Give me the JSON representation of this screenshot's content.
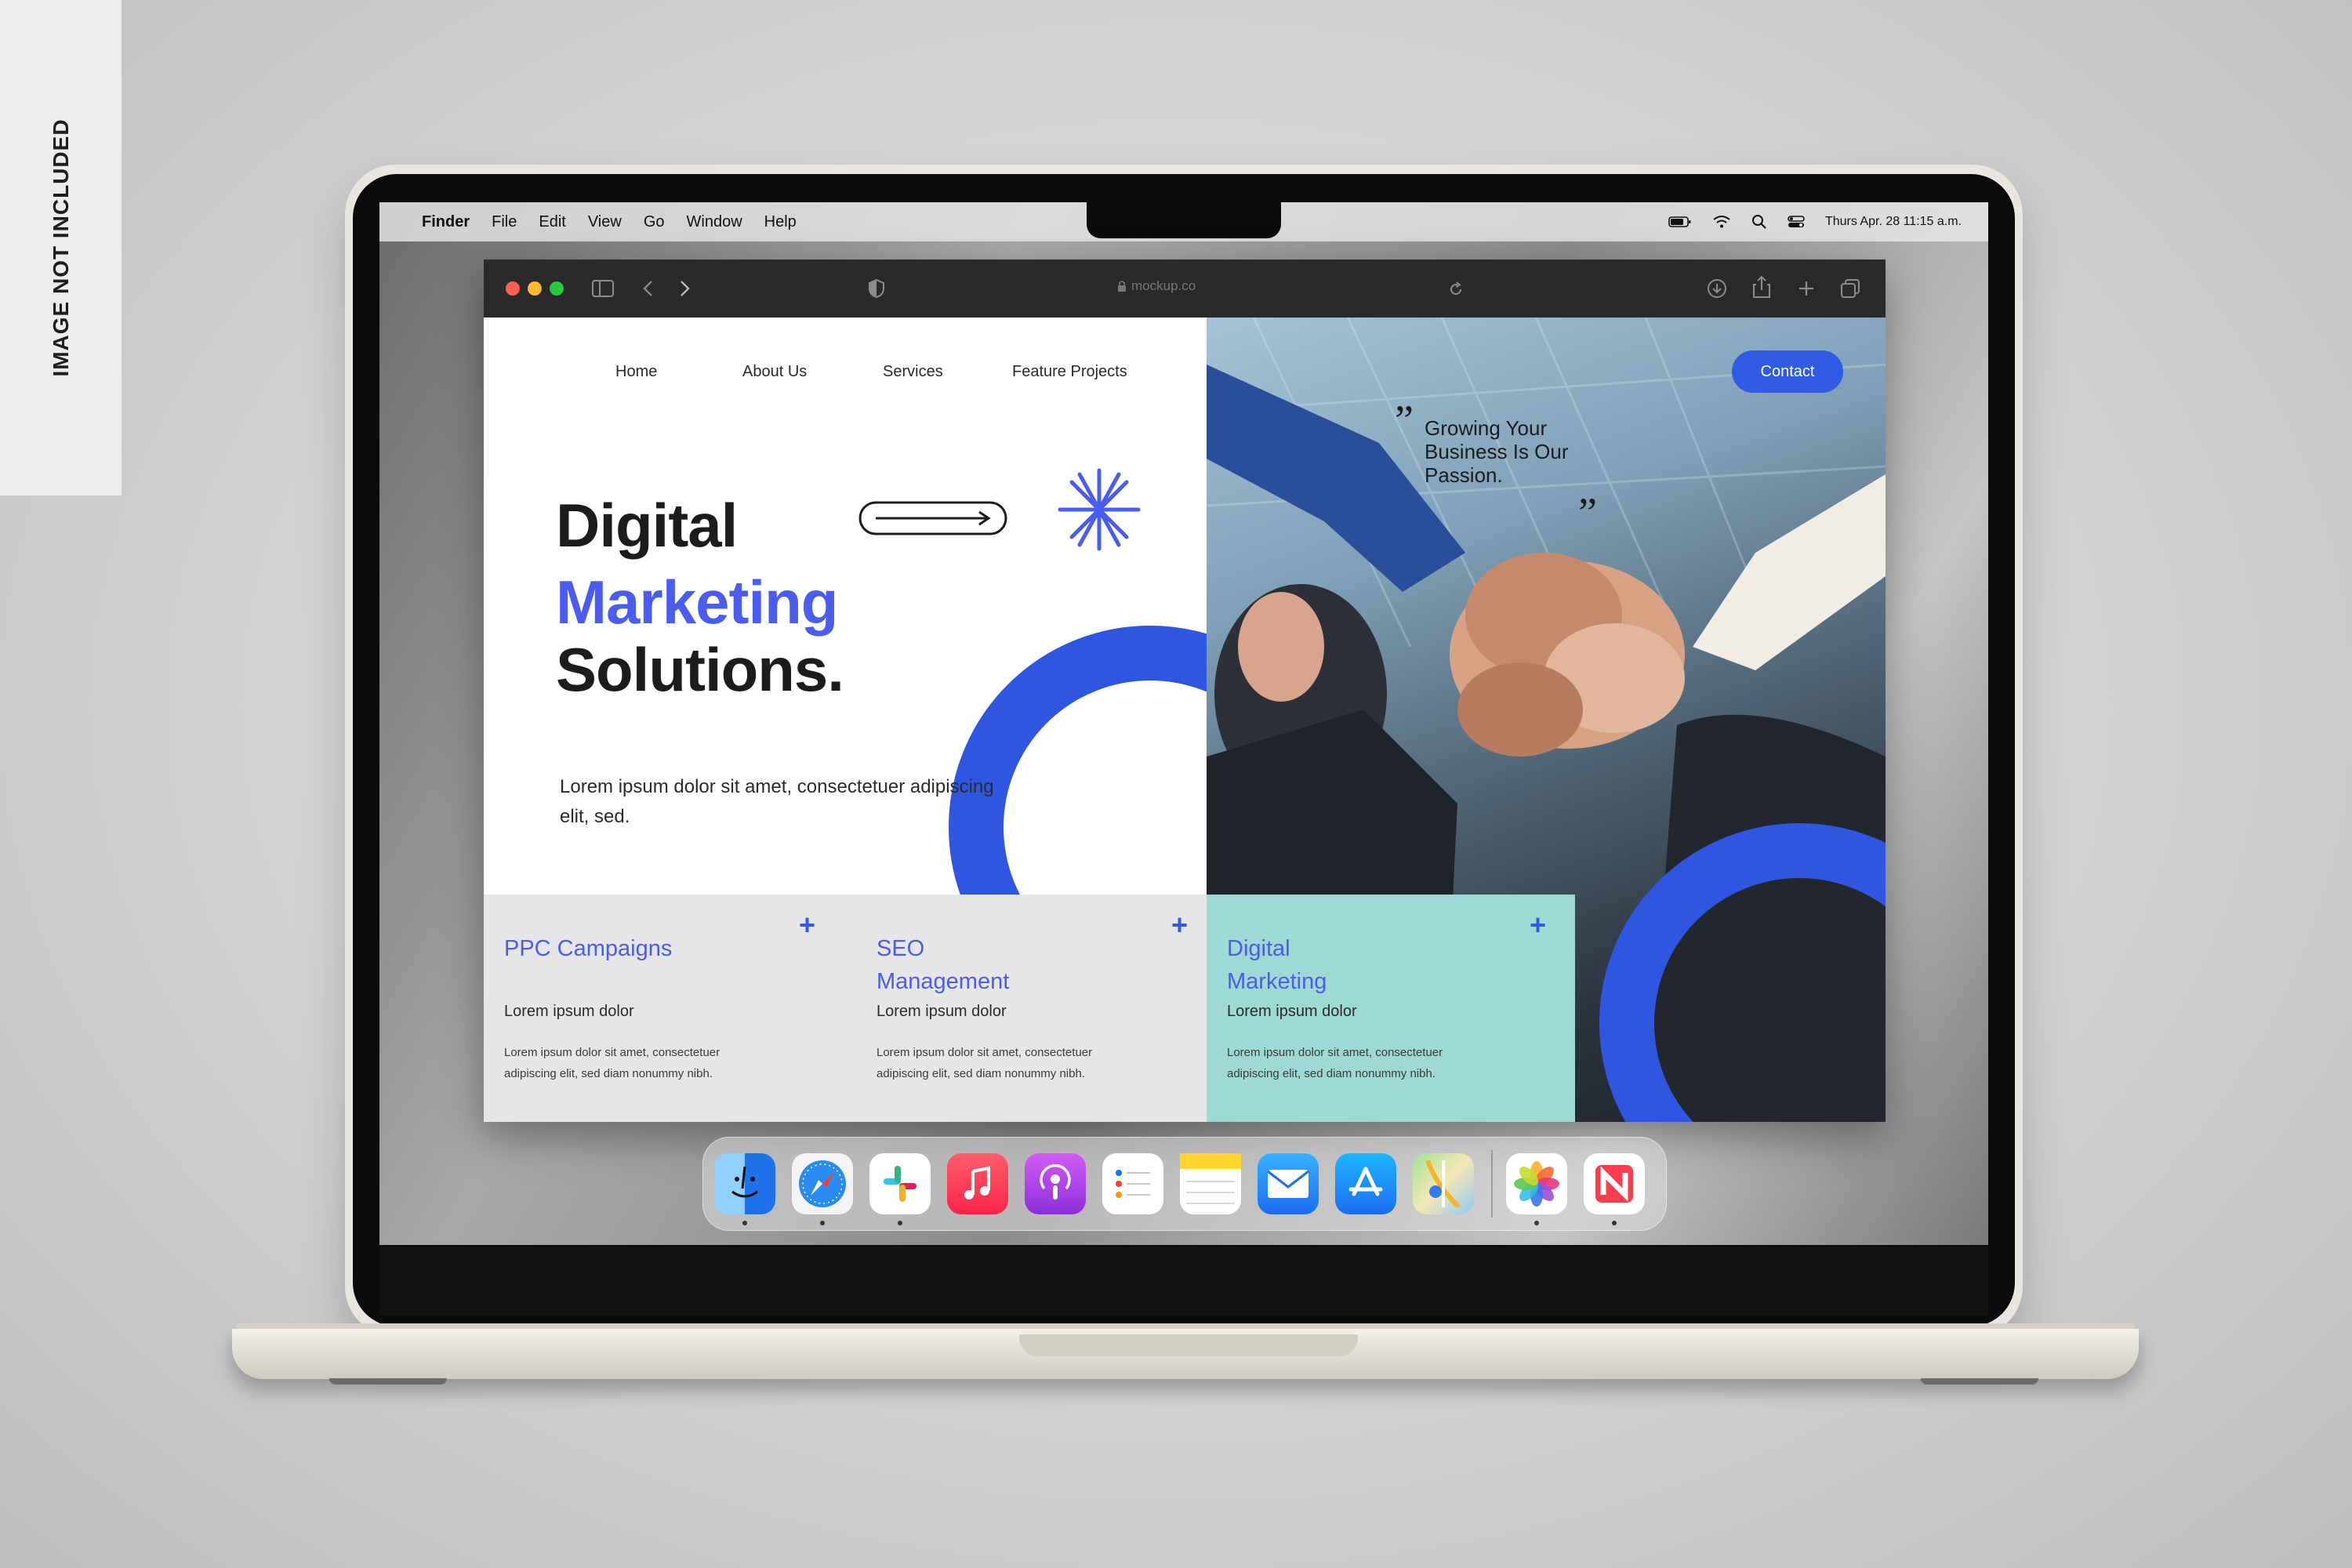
{
  "watermark": {
    "text": "IMAGE NOT INCLUDED"
  },
  "menubar": {
    "apple_icon": "apple-icon",
    "app_name": "Finder",
    "items": [
      "File",
      "Edit",
      "View",
      "Go",
      "Window",
      "Help"
    ],
    "status_icons": [
      "battery-icon",
      "wifi-icon",
      "search-icon",
      "control-center-icon"
    ],
    "datetime": "Thurs Apr. 28 11:15 a.m."
  },
  "browser": {
    "url": "mockup.co",
    "traffic_lights": {
      "close": "#ff5f57",
      "minimize": "#febc2e",
      "zoom": "#28c840"
    }
  },
  "site": {
    "nav": [
      "Home",
      "About Us",
      "Services",
      "Feature Projects"
    ],
    "contact": "Contact",
    "hero": {
      "line1": "Digital",
      "line2": "Marketing",
      "line3": "Solutions.",
      "subtitle": "Lorem ipsum dolor sit amet, consectetuer adipiscing elit, sed."
    },
    "quote": {
      "open_mark": "”",
      "text": "Growing Your Business Is Our Passion.",
      "close_mark": "”"
    },
    "cards": [
      {
        "title": "PPC Campaigns",
        "subtitle": "Lorem ipsum dolor",
        "body": "Lorem ipsum dolor sit amet, consectetuer adipiscing elit, sed diam nonummy nibh.",
        "plus": "+"
      },
      {
        "title": "SEO Management",
        "subtitle": "Lorem ipsum dolor",
        "body": "Lorem ipsum dolor sit amet, consectetuer adipiscing elit, sed diam nonummy nibh.",
        "plus": "+"
      },
      {
        "title": "Digital Marketing",
        "subtitle": "Lorem ipsum dolor",
        "body": "Lorem ipsum dolor sit amet, consectetuer adipiscing elit, sed diam nonummy nibh.",
        "plus": "+"
      }
    ],
    "colors": {
      "accent": "#4b5cf0",
      "button": "#2f5be5",
      "teal": "#9ed9d3",
      "ring": "#2f56e0"
    }
  },
  "dock": {
    "apps": [
      {
        "name": "finder-icon",
        "running": true
      },
      {
        "name": "safari-icon",
        "running": true
      },
      {
        "name": "slack-icon",
        "running": true
      },
      {
        "name": "music-icon",
        "running": false
      },
      {
        "name": "podcasts-icon",
        "running": false
      },
      {
        "name": "reminders-icon",
        "running": false
      },
      {
        "name": "notes-icon",
        "running": false
      },
      {
        "name": "mail-icon",
        "running": false
      },
      {
        "name": "app-store-icon",
        "running": false
      },
      {
        "name": "maps-icon",
        "running": false
      },
      {
        "name": "photos-icon",
        "running": true
      },
      {
        "name": "news-icon",
        "running": true
      }
    ]
  }
}
